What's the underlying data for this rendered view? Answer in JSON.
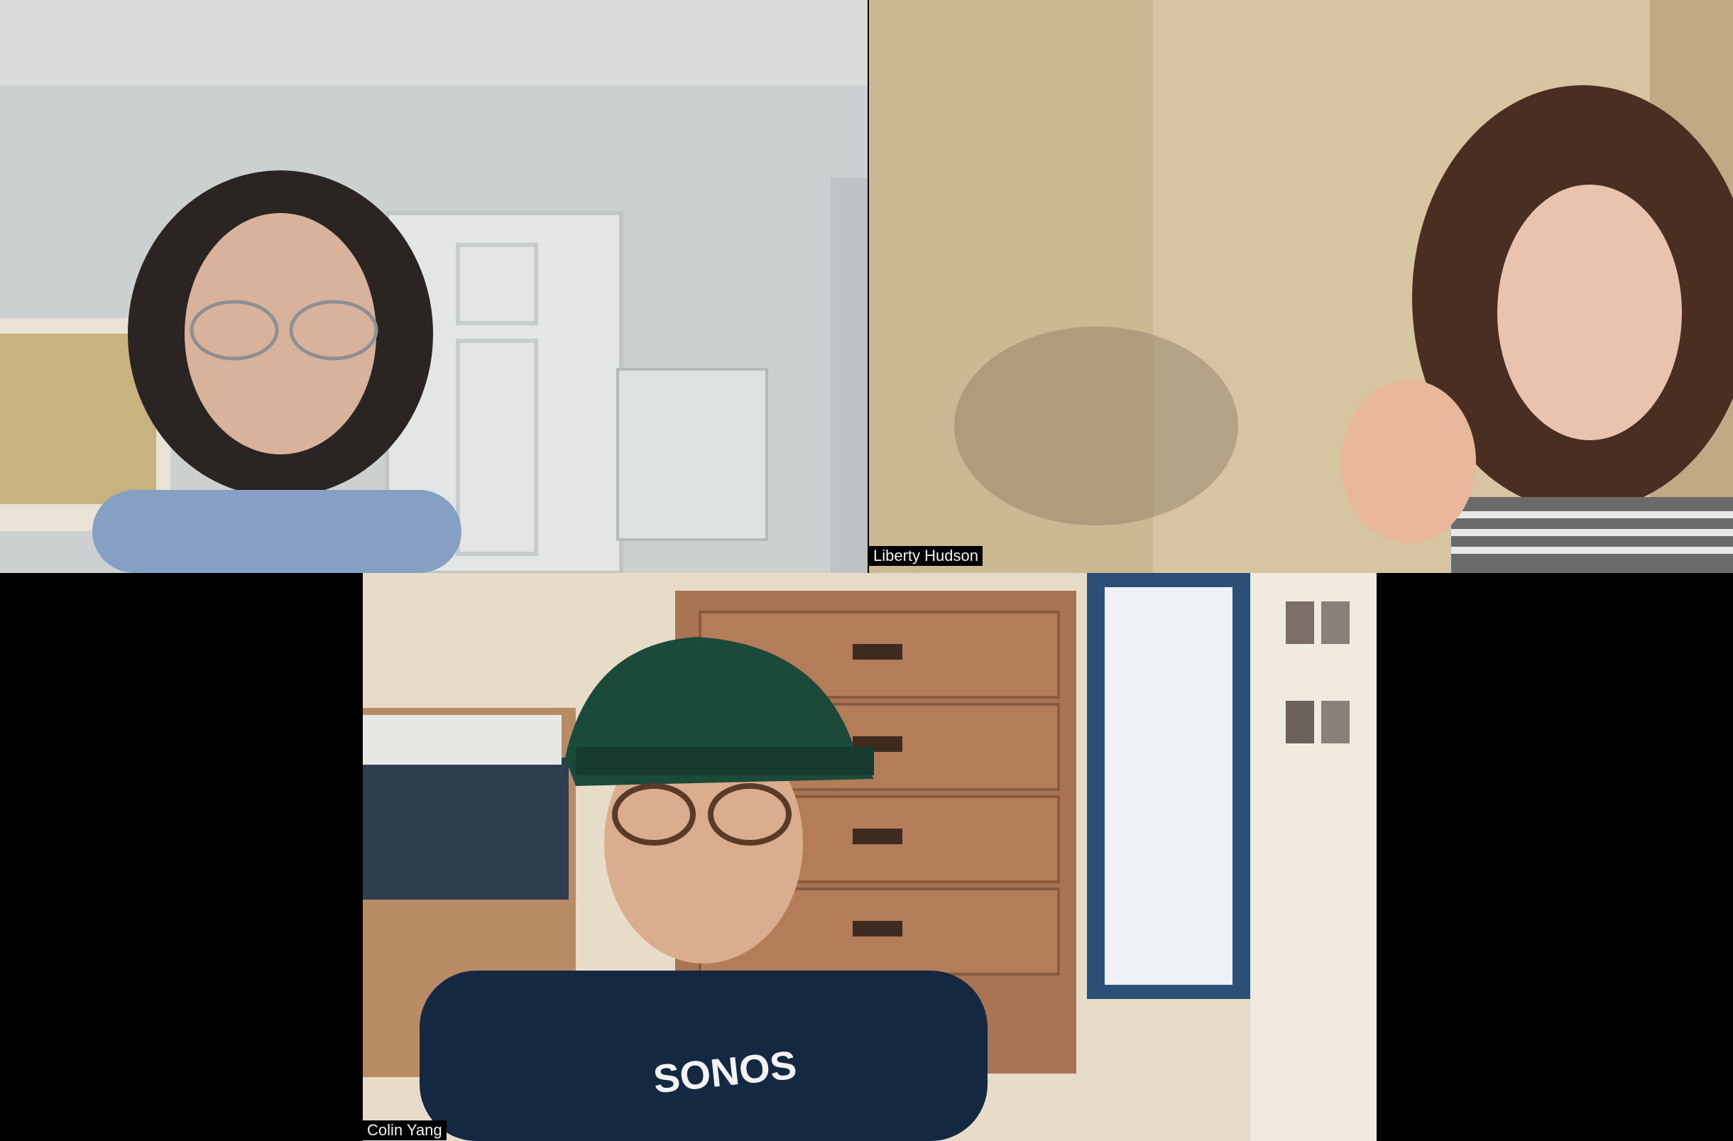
{
  "participants": [
    {
      "name": "",
      "label_visible": false,
      "background": "#cfd2d3"
    },
    {
      "name": "Liberty Hudson",
      "label_visible": true,
      "background": "#d8c7a3"
    },
    {
      "name": "Colin Yang",
      "label_visible": true,
      "background": "#d9cbb4",
      "shirt_text": "SONOS"
    }
  ]
}
